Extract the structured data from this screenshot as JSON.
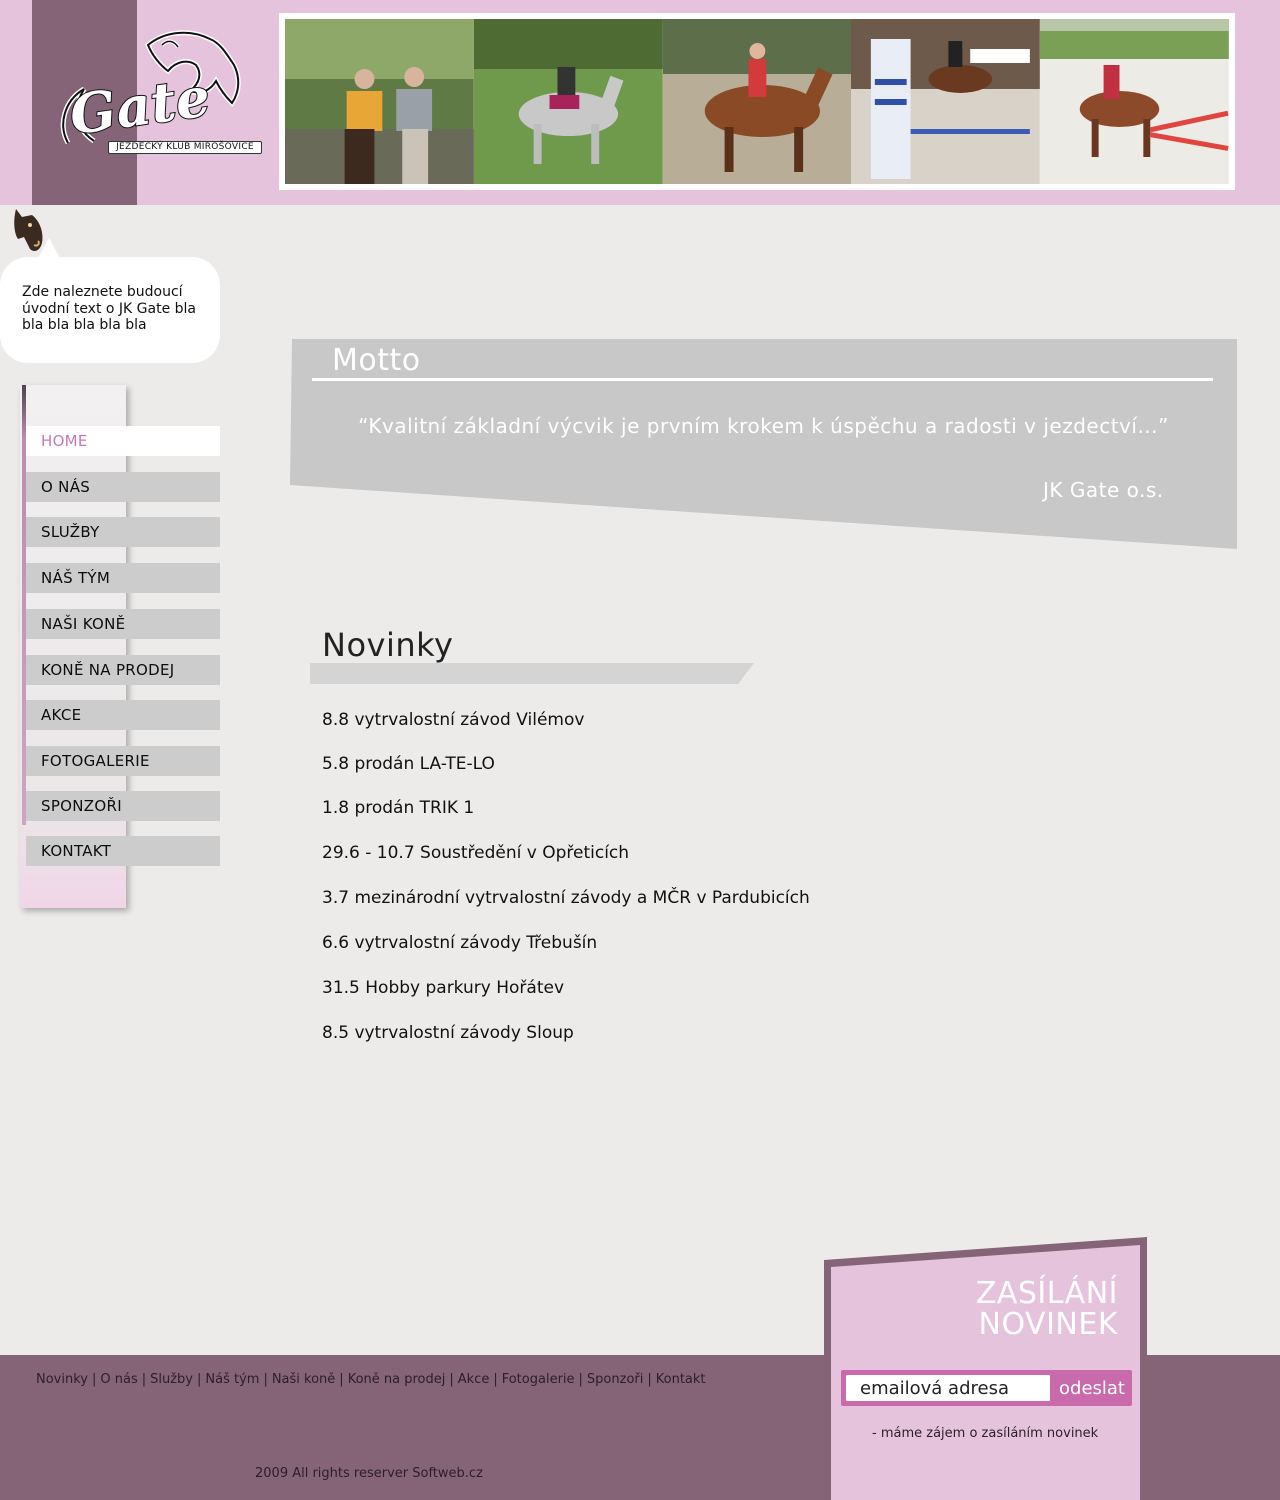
{
  "logo": {
    "subtitle": "JEZDECKÝ KLUB MIROŠOVICE",
    "wordmark": "Gate"
  },
  "banner": {
    "photos": [
      "riders-photo",
      "grey-horse-photo",
      "bay-horse-photo",
      "show-jumping-photo",
      "pony-jump-photo"
    ]
  },
  "intro": {
    "text": "Zde naleznete budoucí úvodní text o JK Gate bla bla bla bla bla bla"
  },
  "menu": {
    "items": [
      {
        "label": "HOME",
        "active": true
      },
      {
        "label": "O NÁS"
      },
      {
        "label": "SLUŽBY"
      },
      {
        "label": "NÁŠ TÝM"
      },
      {
        "label": "NAŠI KONĚ"
      },
      {
        "label": "KONĚ NA PRODEJ"
      },
      {
        "label": "AKCE"
      },
      {
        "label": "FOTOGALERIE"
      },
      {
        "label": "SPONZOŘI"
      },
      {
        "label": "KONTAKT"
      }
    ]
  },
  "motto": {
    "title": "Motto",
    "quote": "“Kvalitní základní výcvik je prvním krokem k úspěchu a radosti v jezdectví...”",
    "author": "JK Gate o.s."
  },
  "news": {
    "title": "Novinky",
    "items": [
      "8.8 vytrvalostní závod Vilémov",
      "5.8 prodán LA-TE-LO",
      "1.8 prodán TRIK 1",
      "29.6 - 10.7 Soustředění v Opřeticích",
      "3.7 mezinárodní vytrvalostní závody a MČR v Pardubicích",
      "6.6 vytrvalostní závody Třebušín",
      "31.5 Hobby parkury Hořátev",
      "8.5 vytrvalostní závody Sloup"
    ]
  },
  "footer": {
    "links": [
      "Novinky",
      "O nás",
      "Služby",
      "Náš tým",
      "Naši koně",
      "Koně na prodej",
      "Akce",
      "Fotogalerie",
      "Sponzoři",
      "Kontakt"
    ],
    "separator": "|",
    "copyright": "2009 All rights reserver Softweb.cz"
  },
  "newsletter": {
    "title_line1": "ZASÍLÁNÍ",
    "title_line2": "NOVINEK",
    "email_placeholder": "emailová adresa",
    "submit_label": "odeslat",
    "note": "- máme zájem o zasíláním novinek"
  },
  "colors": {
    "header_pink": "#e6c3dc",
    "mauve": "#866478",
    "accent_pink": "#c86aac",
    "menu_gray": "#cdcccc",
    "motto_gray": "#c8c8c8",
    "page_bg": "#edebe9"
  }
}
